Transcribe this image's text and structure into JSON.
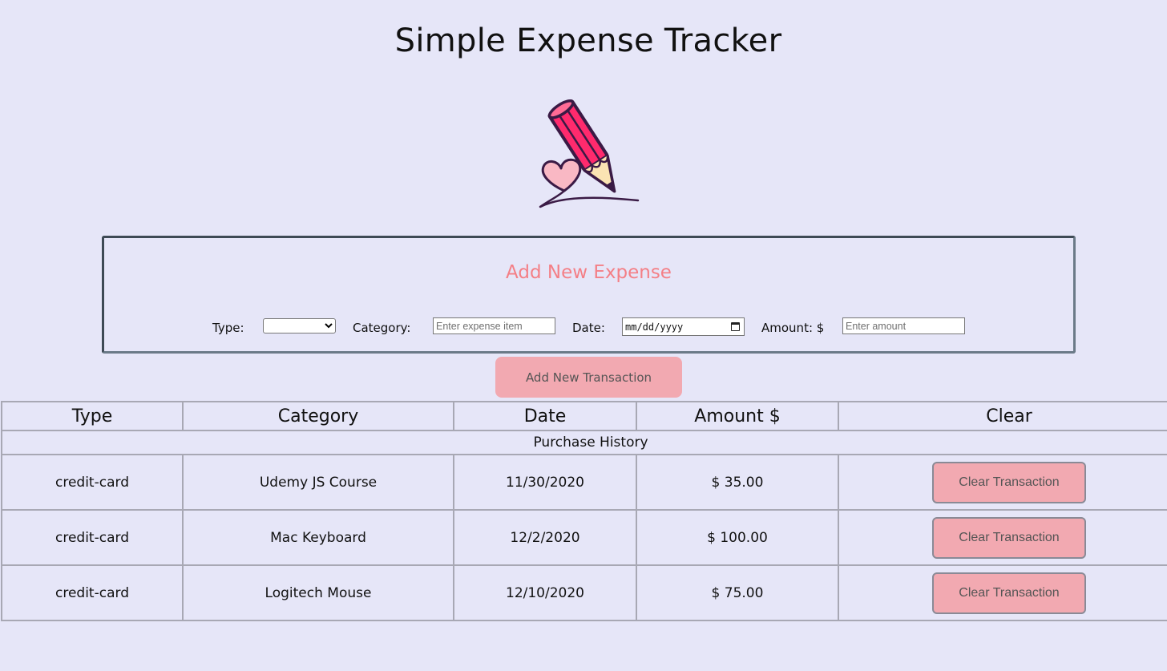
{
  "header": {
    "title": "Simple Expense Tracker",
    "logo_icon": "pencil-heart-icon"
  },
  "form": {
    "title": "Add New Expense",
    "type_label": "Type:",
    "type_selected": "",
    "category_label": "Category:",
    "category_placeholder": "Enter expense item",
    "date_label": "Date:",
    "date_placeholder": "mm/dd/yyyy",
    "amount_label": "Amount: $",
    "amount_placeholder": "Enter amount",
    "submit_label": "Add New Transaction"
  },
  "table": {
    "headers": [
      "Type",
      "Category",
      "Date",
      "Amount $",
      "Clear"
    ],
    "caption": "Purchase History",
    "rows": [
      {
        "type": "credit-card",
        "category": "Udemy JS Course",
        "date": "11/30/2020",
        "amount": "$ 35.00",
        "clear_label": "Clear Transaction"
      },
      {
        "type": "credit-card",
        "category": "Mac Keyboard",
        "date": "12/2/2020",
        "amount": "$ 100.00",
        "clear_label": "Clear Transaction"
      },
      {
        "type": "credit-card",
        "category": "Logitech Mouse",
        "date": "12/10/2020",
        "amount": "$ 75.00",
        "clear_label": "Clear Transaction"
      }
    ]
  },
  "colors": {
    "background": "#e6e6f8",
    "accent_title": "#f47f86",
    "button": "#f2a9b1",
    "pencil_body": "#ff2a6d",
    "heart": "#f9b8c4"
  }
}
